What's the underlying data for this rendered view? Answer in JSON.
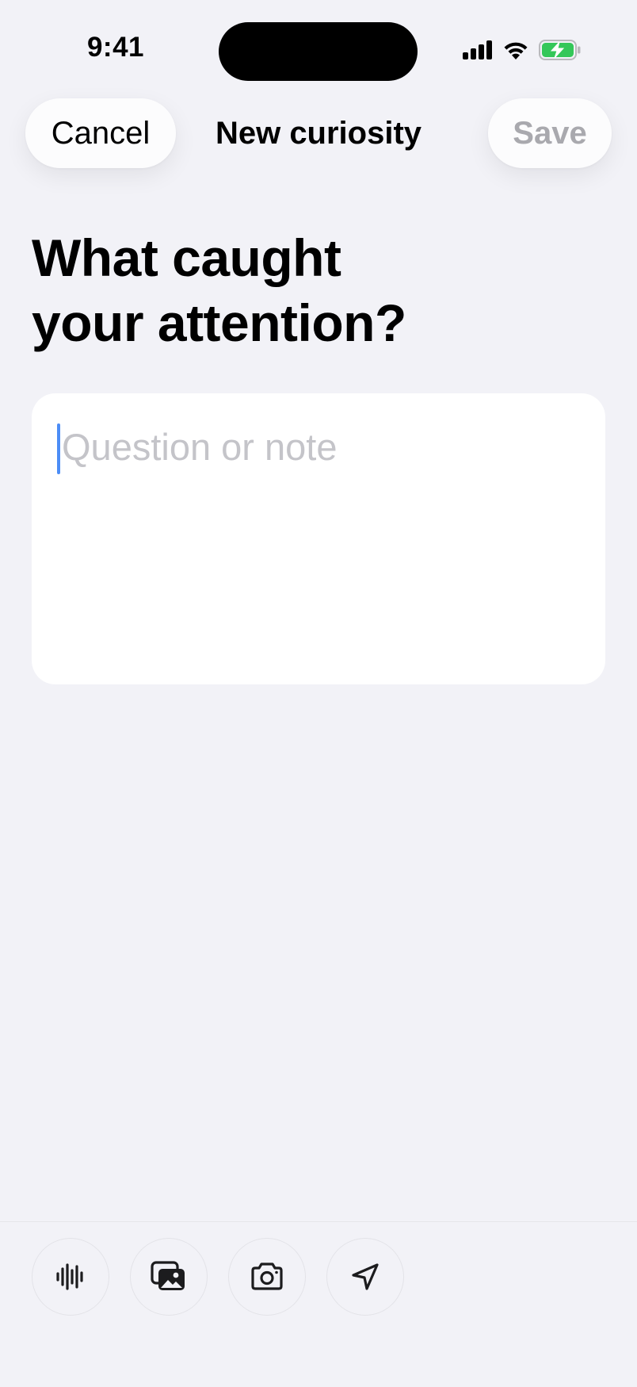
{
  "status_bar": {
    "time": "9:41",
    "icons": [
      "cellular-signal-icon",
      "wifi-icon",
      "battery-charging-icon"
    ],
    "battery_color": "#34c759"
  },
  "nav": {
    "cancel_label": "Cancel",
    "title": "New curiosity",
    "save_label": "Save",
    "save_enabled": false
  },
  "heading": {
    "line1": "What caught",
    "line2": "your attention?"
  },
  "note": {
    "placeholder": "Question or note",
    "value": ""
  },
  "toolbar": {
    "buttons": [
      {
        "name": "audio-waveform-icon",
        "action": "record audio"
      },
      {
        "name": "photos-icon",
        "action": "attach photo"
      },
      {
        "name": "camera-icon",
        "action": "take photo"
      },
      {
        "name": "location-arrow-icon",
        "action": "add location"
      }
    ]
  },
  "colors": {
    "background": "#f2f2f7",
    "card": "#ffffff",
    "caret": "#4c8df6",
    "placeholder": "#c4c4c9",
    "disabled_text": "#a9a9ae"
  }
}
